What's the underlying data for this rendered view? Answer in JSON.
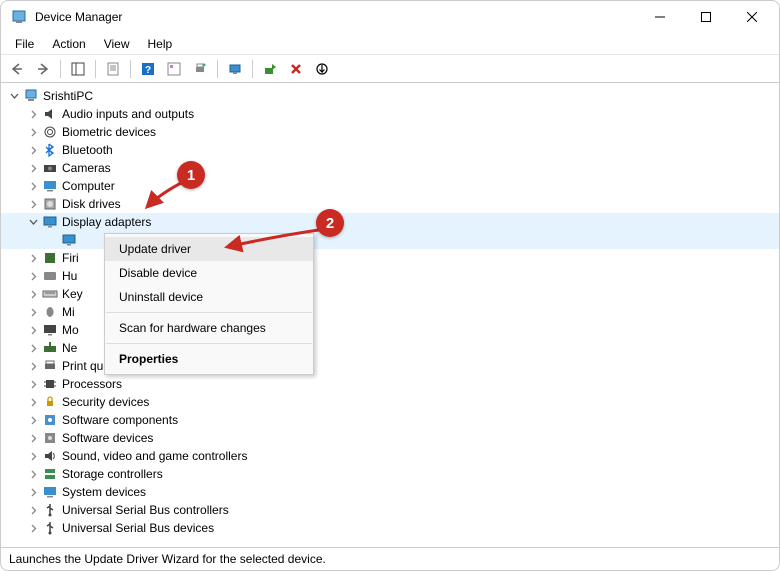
{
  "title": "Device Manager",
  "menus": [
    "File",
    "Action",
    "View",
    "Help"
  ],
  "root_label": "SrishtiPC",
  "nodes": [
    {
      "label": "Audio inputs and outputs",
      "icon": "audio"
    },
    {
      "label": "Biometric devices",
      "icon": "biometric"
    },
    {
      "label": "Bluetooth",
      "icon": "bluetooth"
    },
    {
      "label": "Cameras",
      "icon": "camera"
    },
    {
      "label": "Computer",
      "icon": "computer"
    },
    {
      "label": "Disk drives",
      "icon": "disk"
    },
    {
      "label": "Display adapters",
      "icon": "display",
      "expanded": true
    },
    {
      "label": "Firi",
      "icon": "firmware",
      "truncated": true
    },
    {
      "label": "Hu",
      "icon": "hid",
      "truncated": true
    },
    {
      "label": "Key",
      "icon": "keyboard",
      "truncated": true
    },
    {
      "label": "Mi",
      "icon": "mouse",
      "truncated": true
    },
    {
      "label": "Mo",
      "icon": "monitor",
      "truncated": true
    },
    {
      "label": "Ne",
      "icon": "network",
      "truncated": true
    },
    {
      "label": "Print queues",
      "icon": "printer",
      "truncated_partial": true
    },
    {
      "label": "Processors",
      "icon": "processor"
    },
    {
      "label": "Security devices",
      "icon": "security"
    },
    {
      "label": "Software components",
      "icon": "softcomp"
    },
    {
      "label": "Software devices",
      "icon": "softdev"
    },
    {
      "label": "Sound, video and game controllers",
      "icon": "sound"
    },
    {
      "label": "Storage controllers",
      "icon": "storage"
    },
    {
      "label": "System devices",
      "icon": "system"
    },
    {
      "label": "Universal Serial Bus controllers",
      "icon": "usb"
    },
    {
      "label": "Universal Serial Bus devices",
      "icon": "usb"
    }
  ],
  "context_menu": {
    "items": [
      {
        "label": "Update driver",
        "selected": true
      },
      {
        "label": "Disable device"
      },
      {
        "label": "Uninstall device"
      },
      {
        "sep": true
      },
      {
        "label": "Scan for hardware changes"
      },
      {
        "sep": true
      },
      {
        "label": "Properties",
        "bold": true
      }
    ]
  },
  "annotations": {
    "badge1": "1",
    "badge2": "2"
  },
  "status": "Launches the Update Driver Wizard for the selected device."
}
